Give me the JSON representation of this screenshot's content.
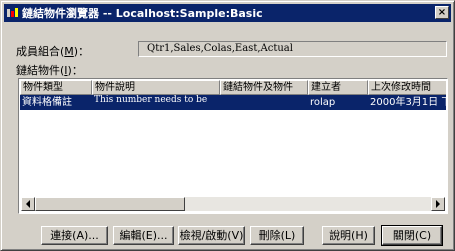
{
  "window": {
    "title": "鏈結物件瀏覽器 -- Localhost:Sample:Basic",
    "close_label": "×"
  },
  "member": {
    "label_prefix": "成員組合(",
    "label_key": "M",
    "label_suffix": ")：",
    "value": "Qtr1,Sales,Colas,East,Actual"
  },
  "objects": {
    "label_prefix": "鏈結物件(",
    "label_key": "I",
    "label_suffix": ")："
  },
  "table": {
    "headers": [
      "物件類型",
      "物件說明",
      "鏈結物件及物件",
      "建立者",
      "上次修改時間"
    ],
    "rows": [
      {
        "type": "資料格備註",
        "description": "This number needs to be",
        "linked": "",
        "creator": "rolap",
        "modified": "2000年3月1日 下"
      }
    ]
  },
  "buttons": {
    "attach": "連接(A)...",
    "edit": "編輯(E)...",
    "view_launch": "檢視/啟動(V)",
    "delete": "刪除(L)",
    "help": "說明(H)",
    "close": "關閉(C)"
  },
  "colors": {
    "titlebar": "#0a246a",
    "selection": "#0a246a",
    "face": "#d4d0c8"
  }
}
